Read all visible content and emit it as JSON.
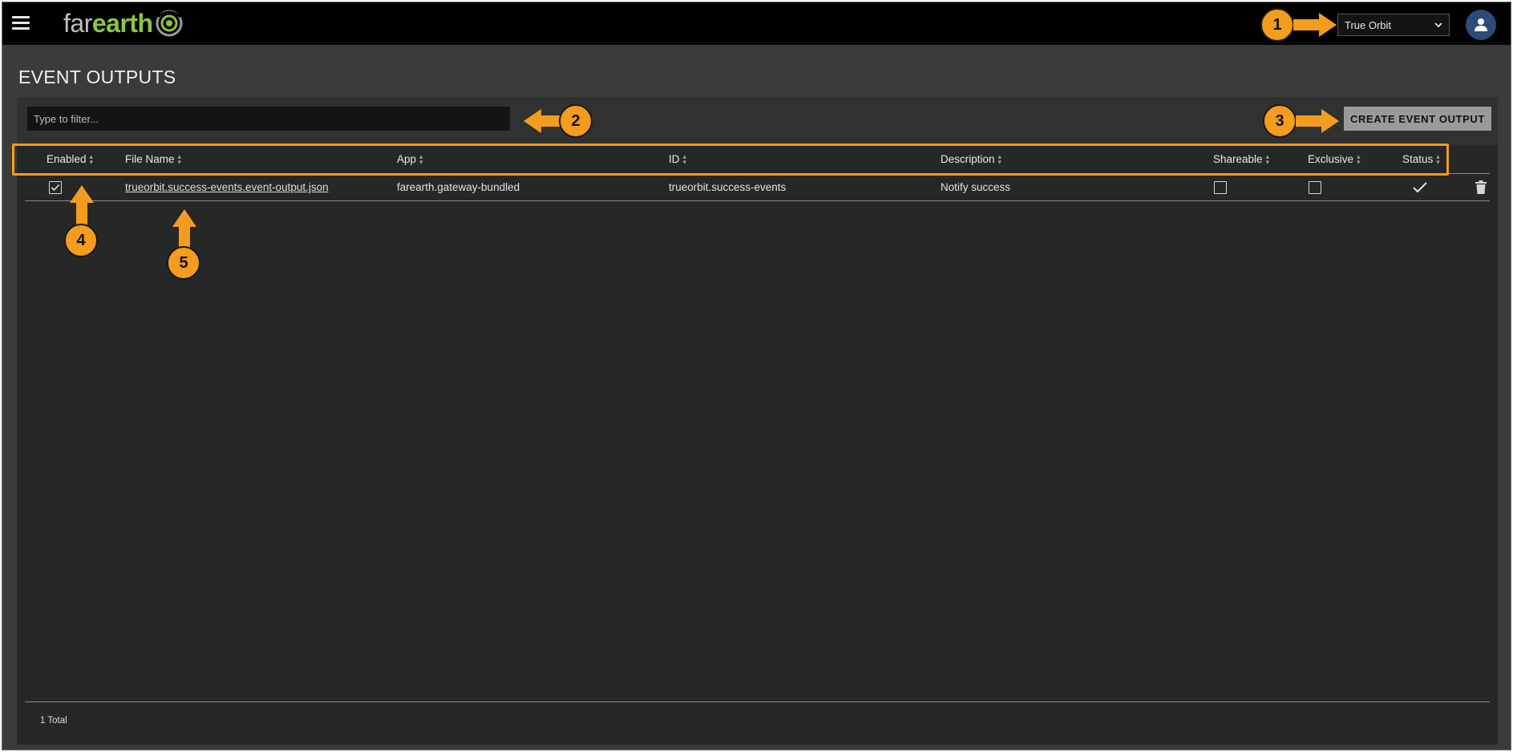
{
  "app": {
    "logo_far": "far",
    "logo_earth": "earth",
    "brand_color": "#8cc63f",
    "accent_annotation": "#f39c1e"
  },
  "topbar": {
    "menu_icon": "hamburger-menu-icon",
    "orbit_select": {
      "value": "True Orbit"
    },
    "avatar_icon": "user-icon"
  },
  "page": {
    "title": "EVENT OUTPUTS"
  },
  "toolbar": {
    "filter_placeholder": "Type to filter...",
    "create_label": "CREATE EVENT OUTPUT"
  },
  "table": {
    "columns": [
      "Enabled",
      "File Name",
      "App",
      "ID",
      "Description",
      "Shareable",
      "Exclusive",
      "Status"
    ],
    "rows": [
      {
        "enabled": true,
        "file_name": "trueorbit.success-events.event-output.json",
        "app": "farearth.gateway-bundled",
        "id": "trueorbit.success-events",
        "description": "Notify success",
        "shareable": false,
        "exclusive": false,
        "status_icon": "check-icon",
        "action_icon": "trash-icon"
      }
    ],
    "total": "1 Total"
  },
  "annotations": [
    "1",
    "2",
    "3",
    "4",
    "5"
  ]
}
